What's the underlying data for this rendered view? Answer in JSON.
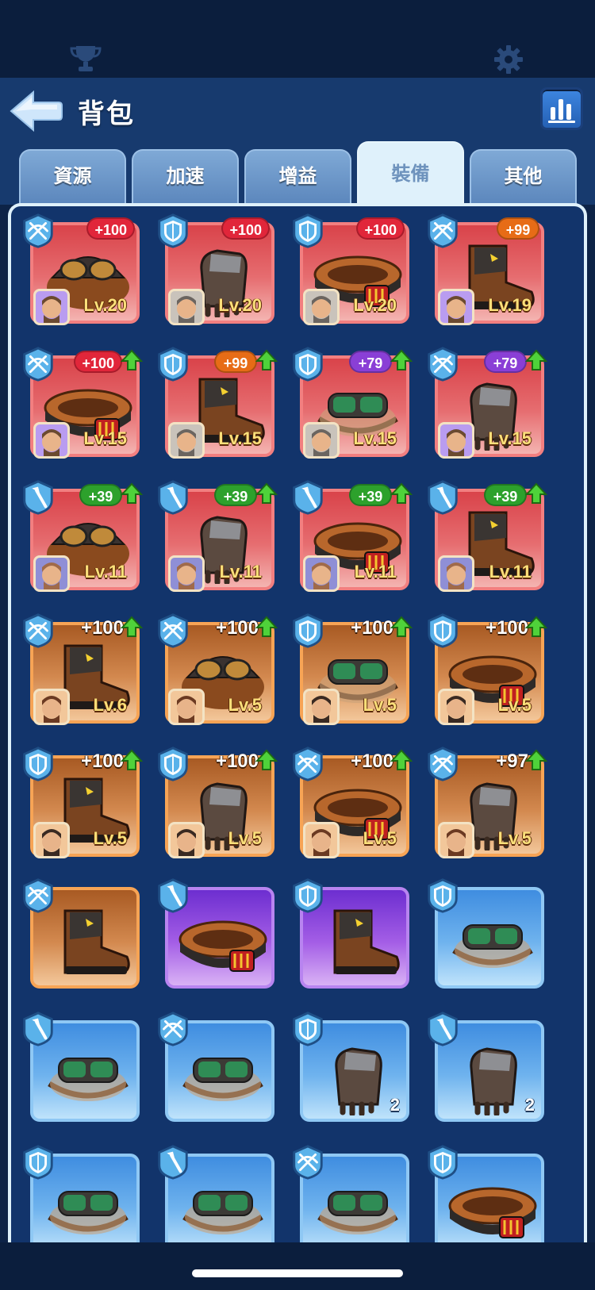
{
  "header": {
    "title": "背包"
  },
  "tabs": [
    {
      "label": "資源",
      "active": false
    },
    {
      "label": "加速",
      "active": false
    },
    {
      "label": "增益",
      "active": false
    },
    {
      "label": "裝備",
      "active": true
    },
    {
      "label": "其他",
      "active": false
    }
  ],
  "items": [
    {
      "rarity": "red",
      "type": "crossbow",
      "bonus": "+100",
      "bonus_color": "red",
      "upgrade": false,
      "level": "Lv.20",
      "hero": "hero-a",
      "piece": "helmet"
    },
    {
      "rarity": "red",
      "type": "shield",
      "bonus": "+100",
      "bonus_color": "red",
      "upgrade": false,
      "level": "Lv.20",
      "hero": "hero-b",
      "piece": "glove"
    },
    {
      "rarity": "red",
      "type": "shield",
      "bonus": "+100",
      "bonus_color": "red",
      "upgrade": false,
      "level": "Lv.20",
      "hero": "hero-b",
      "piece": "belt"
    },
    {
      "rarity": "red",
      "type": "crossbow",
      "bonus": "+99",
      "bonus_color": "orange",
      "upgrade": false,
      "level": "Lv.19",
      "hero": "hero-a",
      "piece": "boot"
    },
    {
      "rarity": "red",
      "type": "crossbow",
      "bonus": "+100",
      "bonus_color": "red",
      "upgrade": true,
      "level": "Lv.15",
      "hero": "hero-a",
      "piece": "belt"
    },
    {
      "rarity": "red",
      "type": "shield",
      "bonus": "+99",
      "bonus_color": "orange",
      "upgrade": true,
      "level": "Lv.15",
      "hero": "hero-b",
      "piece": "boot"
    },
    {
      "rarity": "red",
      "type": "shield",
      "bonus": "+79",
      "bonus_color": "purple",
      "upgrade": true,
      "level": "Lv.15",
      "hero": "hero-b",
      "piece": "goggles"
    },
    {
      "rarity": "red",
      "type": "crossbow",
      "bonus": "+79",
      "bonus_color": "purple",
      "upgrade": true,
      "level": "Lv.15",
      "hero": "hero-a",
      "piece": "glove"
    },
    {
      "rarity": "red",
      "type": "spear",
      "bonus": "+39",
      "bonus_color": "green",
      "upgrade": true,
      "level": "Lv.11",
      "hero": "hero-c",
      "piece": "helmet"
    },
    {
      "rarity": "red",
      "type": "spear",
      "bonus": "+39",
      "bonus_color": "green",
      "upgrade": true,
      "level": "Lv.11",
      "hero": "hero-c",
      "piece": "glove"
    },
    {
      "rarity": "red",
      "type": "spear",
      "bonus": "+39",
      "bonus_color": "green",
      "upgrade": true,
      "level": "Lv.11",
      "hero": "hero-c",
      "piece": "belt"
    },
    {
      "rarity": "red",
      "type": "spear",
      "bonus": "+39",
      "bonus_color": "green",
      "upgrade": true,
      "level": "Lv.11",
      "hero": "hero-c",
      "piece": "boot"
    },
    {
      "rarity": "orange",
      "type": "crossbow",
      "bonus_text": "+100",
      "upgrade": true,
      "level": "Lv.6",
      "hero": "hero-d",
      "piece": "boot"
    },
    {
      "rarity": "orange",
      "type": "crossbow",
      "bonus_text": "+100",
      "upgrade": true,
      "level": "Lv.5",
      "hero": "hero-d",
      "piece": "helmet"
    },
    {
      "rarity": "orange",
      "type": "shield",
      "bonus_text": "+100",
      "upgrade": true,
      "level": "Lv.5",
      "hero": "hero-e",
      "piece": "goggles"
    },
    {
      "rarity": "orange",
      "type": "shield",
      "bonus_text": "+100",
      "upgrade": true,
      "level": "Lv.5",
      "hero": "hero-e",
      "piece": "belt"
    },
    {
      "rarity": "orange",
      "type": "shield",
      "bonus_text": "+100",
      "upgrade": true,
      "level": "Lv.5",
      "hero": "hero-e",
      "piece": "boot"
    },
    {
      "rarity": "orange",
      "type": "shield",
      "bonus_text": "+100",
      "upgrade": true,
      "level": "Lv.5",
      "hero": "hero-e",
      "piece": "glove"
    },
    {
      "rarity": "orange",
      "type": "crossbow",
      "bonus_text": "+100",
      "upgrade": true,
      "level": "Lv.5",
      "hero": "hero-d",
      "piece": "belt"
    },
    {
      "rarity": "orange",
      "type": "crossbow",
      "bonus_text": "+97",
      "upgrade": true,
      "level": "Lv.5",
      "hero": "hero-d",
      "piece": "glove"
    },
    {
      "rarity": "orange",
      "type": "crossbow",
      "piece": "boot"
    },
    {
      "rarity": "purple",
      "type": "spear",
      "piece": "belt"
    },
    {
      "rarity": "purple",
      "type": "shield",
      "piece": "boot"
    },
    {
      "rarity": "blue",
      "type": "shield",
      "piece": "goggles"
    },
    {
      "rarity": "blue",
      "type": "spear",
      "piece": "goggles"
    },
    {
      "rarity": "blue",
      "type": "crossbow",
      "piece": "goggles"
    },
    {
      "rarity": "blue",
      "type": "shield",
      "piece": "glove",
      "count": "2"
    },
    {
      "rarity": "blue",
      "type": "spear",
      "piece": "glove",
      "count": "2"
    },
    {
      "rarity": "blue",
      "type": "shield",
      "piece": "goggles"
    },
    {
      "rarity": "blue",
      "type": "spear",
      "piece": "goggles"
    },
    {
      "rarity": "blue",
      "type": "crossbow",
      "piece": "goggles"
    },
    {
      "rarity": "blue",
      "type": "shield",
      "piece": "belt"
    }
  ],
  "icons": {
    "topbar_left": "trophy-icon",
    "topbar_right": "gear-icon",
    "back": "back-arrow-icon",
    "stats": "bar-chart-icon"
  }
}
